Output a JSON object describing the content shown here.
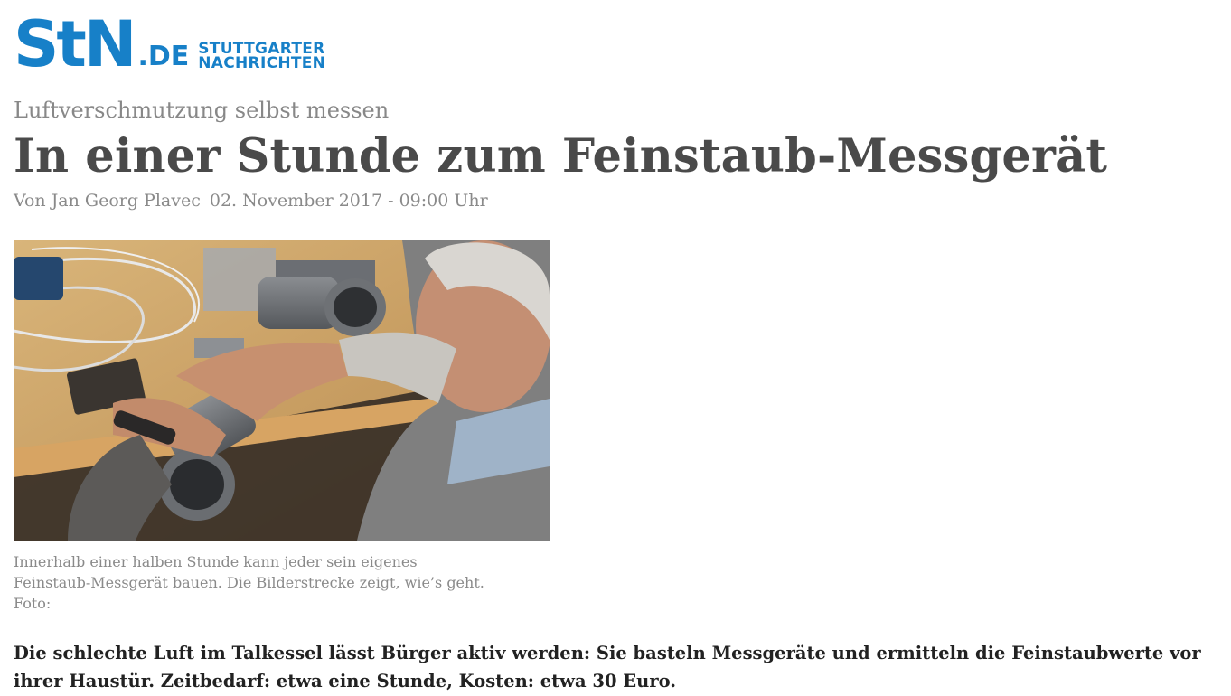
{
  "logo": {
    "main": "StN",
    "domain": ".DE",
    "name_line1": "STUTTGARTER",
    "name_line2": "NACHRICHTEN",
    "brand_color": "#1780c8"
  },
  "article": {
    "kicker": "Luftverschmutzung selbst messen",
    "headline": "In einer Stunde zum Feinstaub-Messgerät",
    "author": "Von Jan Georg Plavec",
    "date": "02. November 2017 - 09:00 Uhr",
    "caption_line1": "Innerhalb einer halben Stunde kann jeder sein eigenes",
    "caption_line2": "Feinstaub-Messgerät bauen. Die Bilderstrecke zeigt, wie’s geht.",
    "caption_line3": "Foto:",
    "lead": "Die schlechte Luft im Talkessel lässt Bürger aktiv werden: Sie basteln Messgeräte und ermitteln die Feinstaubwerte vor ihrer Haustür. Zeitbedarf: etwa eine Stunde, Kosten: etwa 30 Euro."
  }
}
